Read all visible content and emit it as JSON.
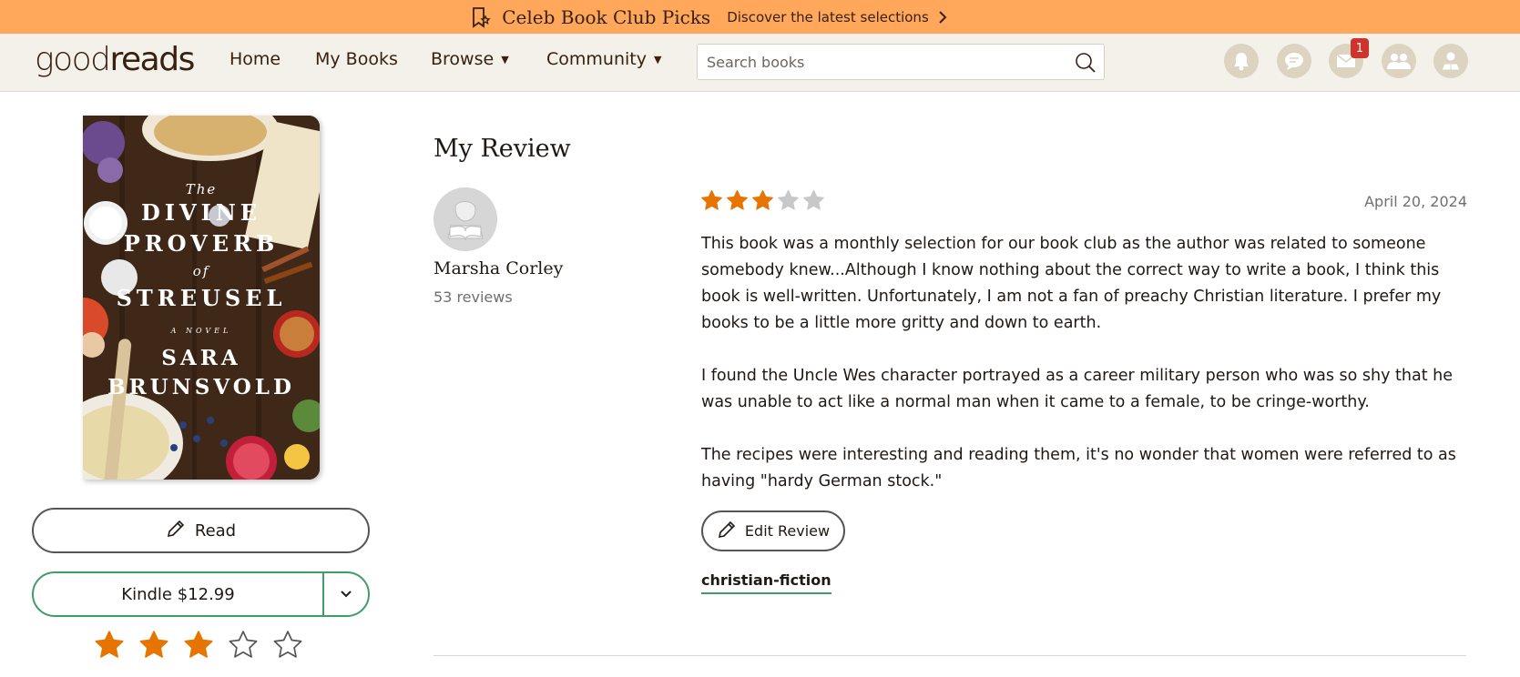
{
  "promo": {
    "icon": "bookmark-star-icon",
    "title": "Celeb Book Club Picks",
    "subtitle": "Discover the latest selections"
  },
  "header": {
    "logo_good": "good",
    "logo_reads": "reads",
    "nav": [
      {
        "label": "Home"
      },
      {
        "label": "My Books"
      },
      {
        "label": "Browse",
        "caret": "▼"
      },
      {
        "label": "Community",
        "caret": "▼"
      }
    ],
    "search": {
      "placeholder": "Search books",
      "value": ""
    },
    "icons": [
      {
        "name": "notifications-icon"
      },
      {
        "name": "discussions-icon"
      },
      {
        "name": "messages-icon",
        "badge": "1"
      },
      {
        "name": "friends-icon"
      },
      {
        "name": "profile-icon"
      }
    ]
  },
  "book": {
    "cover": {
      "the": "The",
      "title_line1": "DIVINE",
      "title_line2": "PROVERB",
      "of": "of",
      "title_line3": "STREUSEL",
      "novel": "A NOVEL",
      "author_line1": "SARA",
      "author_line2": "BRUNSVOLD"
    },
    "read_label": "Read",
    "kindle_label": "Kindle $12.99",
    "user_rating": 3,
    "rating_max": 5
  },
  "review": {
    "section_title": "My Review",
    "reviewer_name": "Marsha Corley",
    "reviewer_count": "53 reviews",
    "rating": 3,
    "rating_max": 5,
    "date": "April 20, 2024",
    "paragraphs": [
      "This book was a monthly selection for our book club as the author was related to someone somebody knew...Although I know nothing about the correct way to write a book, I think this book is well-written. Unfortunately, I am not a fan of preachy Christian literature. I prefer my books to be a little more gritty and down to earth.",
      "I found the Uncle Wes character portrayed as a career military person who was so shy that he was unable to act like a normal man when it came to a female, to be cringe-worthy.",
      "The recipes were interesting and reading them, it's no wonder that women were referred to as having \"hardy German stock.\""
    ],
    "edit_label": "Edit Review",
    "shelf_tag": "christian-fiction"
  },
  "colors": {
    "promo_bg": "#ffa75a",
    "header_bg": "#f4f1ea",
    "star_filled": "#e87400",
    "star_empty_review": "#c8c8c8",
    "kindle_border": "#409d69",
    "badge": "#d0332b"
  }
}
